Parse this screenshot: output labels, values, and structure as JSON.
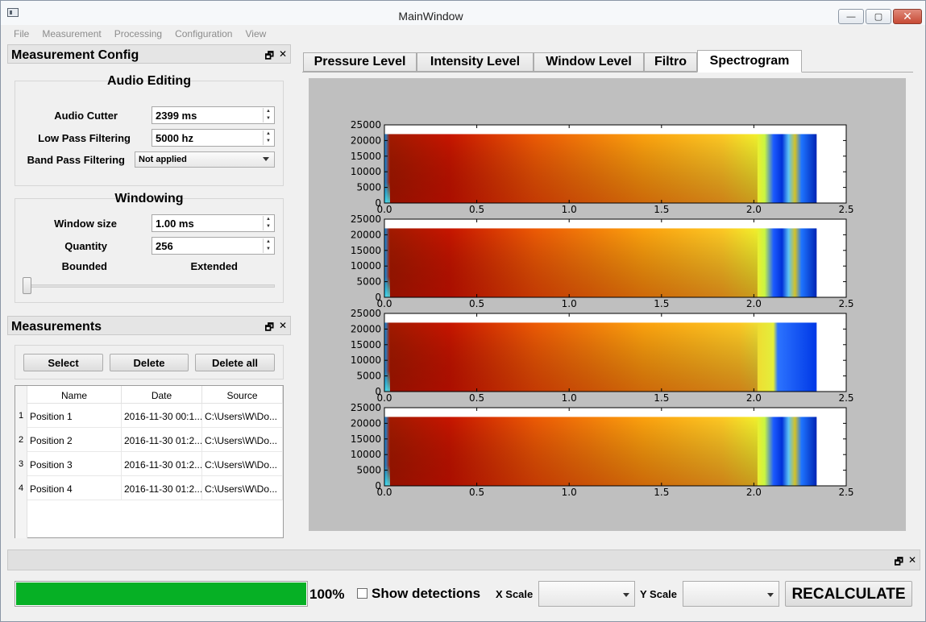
{
  "window": {
    "title": "MainWindow",
    "controls": {
      "minimize": "—",
      "maximize": "▢",
      "close": "✕"
    }
  },
  "menu": [
    "File",
    "Measurement",
    "Processing",
    "Configuration",
    "View"
  ],
  "measurement_config": {
    "title": "Measurement Config",
    "float_icon": "🗗",
    "close_icon": "✕",
    "audio_editing": {
      "title": "Audio Editing",
      "audio_cutter_label": "Audio Cutter",
      "audio_cutter_value": "2399 ms",
      "low_pass_label": "Low Pass Filtering",
      "low_pass_value": "5000 hz",
      "band_pass_label": "Band Pass Filtering",
      "band_pass_value": "Not applied"
    },
    "windowing": {
      "title": "Windowing",
      "window_size_label": "Window size",
      "window_size_value": "1.00 ms",
      "quantity_label": "Quantity",
      "quantity_value": "256",
      "bounded_label": "Bounded",
      "extended_label": "Extended",
      "slider_value": 0
    }
  },
  "measurements": {
    "title": "Measurements",
    "select_label": "Select",
    "delete_label": "Delete",
    "delete_all_label": "Delete all",
    "columns": [
      "Name",
      "Date",
      "Source"
    ],
    "rows": [
      {
        "n": "1",
        "name": "Position 1",
        "date": "2016-11-30 00:1...",
        "source": "C:\\Users\\W\\Do..."
      },
      {
        "n": "2",
        "name": "Position 2",
        "date": "2016-11-30 01:2...",
        "source": "C:\\Users\\W\\Do..."
      },
      {
        "n": "3",
        "name": "Position 3",
        "date": "2016-11-30 01:2...",
        "source": "C:\\Users\\W\\Do..."
      },
      {
        "n": "4",
        "name": "Position 4",
        "date": "2016-11-30 01:2...",
        "source": "C:\\Users\\W\\Do..."
      }
    ]
  },
  "tabs": [
    "Pressure Level",
    "Intensity Level",
    "Window Level",
    "Filtro",
    "Spectrogram"
  ],
  "active_tab": "Spectrogram",
  "chart_data": {
    "type": "heatmap",
    "panels": 4,
    "x_ticks": [
      "0.0",
      "0.5",
      "1.0",
      "1.5",
      "2.0",
      "2.5"
    ],
    "y_ticks": [
      "0",
      "5000",
      "10000",
      "15000",
      "20000",
      "25000"
    ],
    "xlim": [
      0,
      2.5
    ],
    "ylim": [
      0,
      25000
    ],
    "data_extent_x": [
      0,
      2.34
    ],
    "data_extent_y": [
      0,
      22050
    ],
    "colormap": "jet"
  },
  "bottom": {
    "float_icon": "🗗",
    "close_icon": "✕",
    "progress": 100,
    "progress_text": "100%",
    "show_detections_label": "Show detections",
    "x_scale_label": "X Scale",
    "y_scale_label": "Y Scale",
    "recalculate_label": "RECALCULATE",
    "progress_color": "#06b025"
  }
}
